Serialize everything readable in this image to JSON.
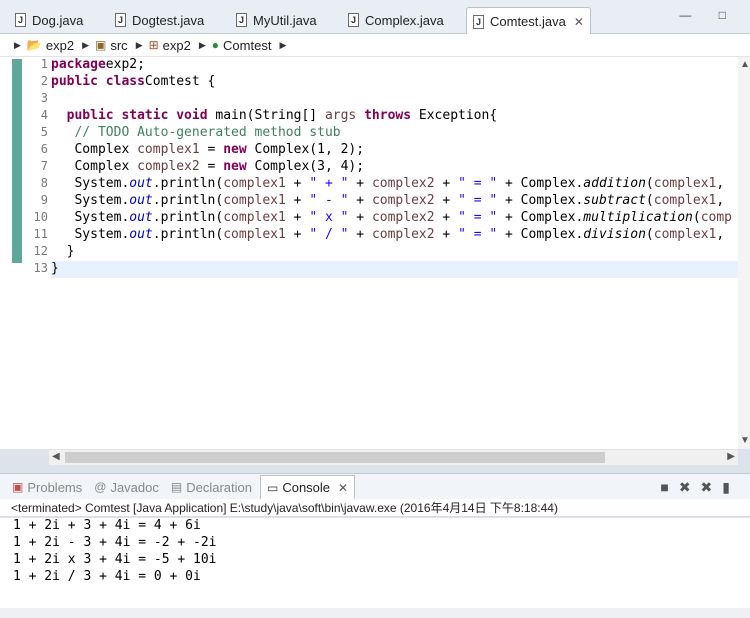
{
  "tabs": [
    {
      "label": "Dog.java",
      "active": false
    },
    {
      "label": "Dogtest.java",
      "active": false
    },
    {
      "label": "MyUtil.java",
      "active": false
    },
    {
      "label": "Complex.java",
      "active": false
    },
    {
      "label": "Comtest.java",
      "active": true
    }
  ],
  "tab_close_glyph": "✕",
  "window_controls": "— □",
  "breadcrumb": [
    "exp2",
    "src",
    "exp2",
    "Comtest"
  ],
  "code_lines": [
    [
      [
        "kw",
        "package"
      ],
      [
        "",
        "exp2;"
      ]
    ],
    [
      [
        "kw",
        "public class"
      ],
      [
        "",
        "Comtest {"
      ]
    ],
    [
      [
        "",
        ""
      ]
    ],
    [
      [
        "",
        "  "
      ],
      [
        "kw",
        "public static void"
      ],
      [
        "",
        " main(String[] "
      ],
      [
        "var",
        "args"
      ],
      [
        "",
        " "
      ],
      [
        "kw",
        "throws"
      ],
      [
        "",
        " Exception{"
      ]
    ],
    [
      [
        "",
        "   "
      ],
      [
        "cm",
        "// TODO Auto-generated method stub"
      ]
    ],
    [
      [
        "",
        "   Complex "
      ],
      [
        "var",
        "complex1"
      ],
      [
        "",
        " = "
      ],
      [
        "kw",
        "new"
      ],
      [
        "",
        " Complex(1, 2);"
      ]
    ],
    [
      [
        "",
        "   Complex "
      ],
      [
        "var",
        "complex2"
      ],
      [
        "",
        " = "
      ],
      [
        "kw",
        "new"
      ],
      [
        "",
        " Complex(3, 4);"
      ]
    ],
    [
      [
        "",
        "   System."
      ],
      [
        "fld",
        "out"
      ],
      [
        "",
        ".println("
      ],
      [
        "var",
        "complex1"
      ],
      [
        "",
        " + "
      ],
      [
        "st",
        "\" + \""
      ],
      [
        "",
        " + "
      ],
      [
        "var",
        "complex2"
      ],
      [
        "",
        " + "
      ],
      [
        "st",
        "\" = \""
      ],
      [
        "",
        " + Complex."
      ],
      [
        "it",
        "addition"
      ],
      [
        "",
        "("
      ],
      [
        "var",
        "complex1"
      ],
      [
        "",
        ","
      ]
    ],
    [
      [
        "",
        "   System."
      ],
      [
        "fld",
        "out"
      ],
      [
        "",
        ".println("
      ],
      [
        "var",
        "complex1"
      ],
      [
        "",
        " + "
      ],
      [
        "st",
        "\" - \""
      ],
      [
        "",
        " + "
      ],
      [
        "var",
        "complex2"
      ],
      [
        "",
        " + "
      ],
      [
        "st",
        "\" = \""
      ],
      [
        "",
        " + Complex."
      ],
      [
        "it",
        "subtract"
      ],
      [
        "",
        "("
      ],
      [
        "var",
        "complex1"
      ],
      [
        "",
        ","
      ]
    ],
    [
      [
        "",
        "   System."
      ],
      [
        "fld",
        "out"
      ],
      [
        "",
        ".println("
      ],
      [
        "var",
        "complex1"
      ],
      [
        "",
        " + "
      ],
      [
        "st",
        "\" x \""
      ],
      [
        "",
        " + "
      ],
      [
        "var",
        "complex2"
      ],
      [
        "",
        " + "
      ],
      [
        "st",
        "\" = \""
      ],
      [
        "",
        " + Complex."
      ],
      [
        "it",
        "multiplication"
      ],
      [
        "",
        "("
      ],
      [
        "var",
        "comp"
      ]
    ],
    [
      [
        "",
        "   System."
      ],
      [
        "fld",
        "out"
      ],
      [
        "",
        ".println("
      ],
      [
        "var",
        "complex1"
      ],
      [
        "",
        " + "
      ],
      [
        "st",
        "\" / \""
      ],
      [
        "",
        " + "
      ],
      [
        "var",
        "complex2"
      ],
      [
        "",
        " + "
      ],
      [
        "st",
        "\" = \""
      ],
      [
        "",
        " + Complex."
      ],
      [
        "it",
        "division"
      ],
      [
        "",
        "("
      ],
      [
        "var",
        "complex1"
      ],
      [
        "",
        ","
      ]
    ],
    [
      [
        "",
        "  }"
      ]
    ],
    [
      [
        "",
        "}"
      ]
    ]
  ],
  "current_line": 13,
  "console_tabs": [
    {
      "label": "Problems",
      "icon": "problems-icon",
      "active": false
    },
    {
      "label": "Javadoc",
      "icon": "at-icon",
      "active": false
    },
    {
      "label": "Declaration",
      "icon": "declaration-icon",
      "active": false
    },
    {
      "label": "Console",
      "icon": "console-icon",
      "active": true
    }
  ],
  "console_header": "<terminated> Comtest [Java Application] E:\\study\\java\\soft\\bin\\javaw.exe (2016年4月14日 下午8:18:44)",
  "console_output": [
    "1 + 2i + 3 + 4i = 4 + 6i",
    "1 + 2i - 3 + 4i = -2 + -2i",
    "1 + 2i x 3 + 4i = -5 + 10i",
    "1 + 2i / 3 + 4i = 0 + 0i"
  ],
  "colors": {
    "keyword": "#7f0055",
    "comment": "#3f7f5f",
    "string": "#2a00ff",
    "field": "#0000c0",
    "change_bar": "#5fa89b"
  }
}
